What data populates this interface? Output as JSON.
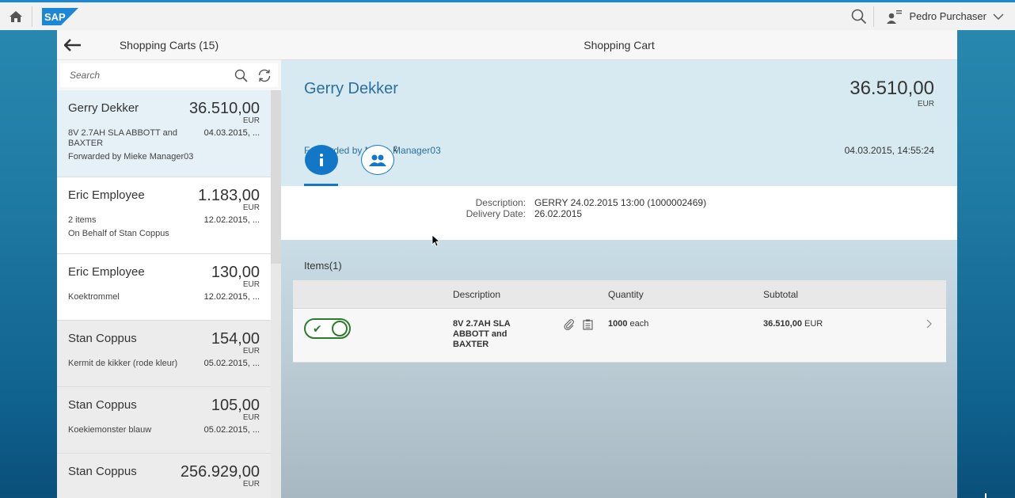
{
  "shell": {
    "logo": "SAP",
    "user_name": "Pedro Purchaser"
  },
  "master": {
    "title": "Shopping Carts (15)",
    "search_placeholder": "Search",
    "items": [
      {
        "name": "Gerry Dekker",
        "amount": "36.510,00",
        "currency": "EUR",
        "desc": "8V 2.7AH SLA ABBOTT and BAXTER",
        "date": "04.03.2015, ...",
        "note": "Forwarded by Mieke Manager03"
      },
      {
        "name": "Eric Employee",
        "amount": "1.183,00",
        "currency": "EUR",
        "desc": "2 items",
        "date": "12.02.2015, ...",
        "note": "On Behalf of Stan Coppus"
      },
      {
        "name": "Eric Employee",
        "amount": "130,00",
        "currency": "EUR",
        "desc": "Koektrommel",
        "date": "12.02.2015, ...",
        "note": ""
      },
      {
        "name": "Stan Coppus",
        "amount": "154,00",
        "currency": "EUR",
        "desc": "Kermit de kikker (rode kleur)",
        "date": "05.02.2015, ...",
        "note": ""
      },
      {
        "name": "Stan Coppus",
        "amount": "105,00",
        "currency": "EUR",
        "desc": "Koekiemonster blauw",
        "date": "05.02.2015, ...",
        "note": ""
      },
      {
        "name": "Stan Coppus",
        "amount": "256.929,00",
        "currency": "EUR",
        "desc": "",
        "date": "",
        "note": ""
      }
    ]
  },
  "detail": {
    "page_title": "Shopping Cart",
    "header": {
      "title": "Gerry Dekker",
      "amount": "36.510,00",
      "currency": "EUR",
      "subtitle": "Forwarded by Mieke Manager03",
      "date": "04.03.2015, 14:55:24"
    },
    "tabs": {
      "info_icon": "info-icon",
      "people_icon": "people-icon",
      "people_count": "2"
    },
    "info": {
      "description_label": "Description:",
      "description_value": "GERRY 24.02.2015 13:00 (1000002469)",
      "delivery_label": "Delivery Date:",
      "delivery_value": "26.02.2015"
    },
    "items": {
      "title": "Items(1)",
      "columns": [
        "Description",
        "Quantity",
        "Subtotal"
      ],
      "rows": [
        {
          "description": "8V 2.7AH SLA ABBOTT and BAXTER",
          "quantity": "1000",
          "unit": "each",
          "subtotal": "36.510,00",
          "currency": "EUR"
        }
      ]
    }
  },
  "colors": {
    "accent": "#1177c6",
    "title_blue": "#2b6f9f",
    "approve_green": "#2b7d2b"
  }
}
